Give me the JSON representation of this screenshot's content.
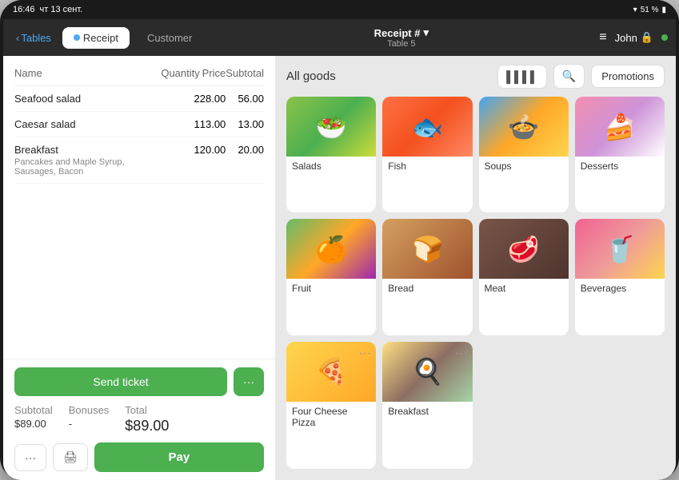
{
  "status_bar": {
    "time": "16:46",
    "date": "чт 13 сент.",
    "battery": "51 %",
    "wifi": "▾"
  },
  "nav": {
    "back_label": "Tables",
    "tabs": [
      {
        "id": "receipt",
        "label": "Receipt",
        "active": true
      },
      {
        "id": "customer",
        "label": "Customer",
        "active": false
      }
    ],
    "receipt_title": "Receipt #",
    "receipt_chevron": "▾",
    "table_subtitle": "Table 5",
    "hamburger_icon": "≡",
    "user_name": "John",
    "lock_icon": "🔒"
  },
  "order": {
    "columns": {
      "name": "Name",
      "quantity": "Quantity",
      "price": "Price",
      "subtotal": "Subtotal"
    },
    "items": [
      {
        "name": "Seafood salad",
        "description": "",
        "quantity": "2",
        "price": "28.00",
        "subtotal": "56.00"
      },
      {
        "name": "Caesar salad",
        "description": "",
        "quantity": "1",
        "price": "13.00",
        "subtotal": "13.00"
      },
      {
        "name": "Breakfast",
        "description": "Pancakes and Maple Syrup, Sausages, Bacon",
        "quantity": "1",
        "price": "20.00",
        "subtotal": "20.00"
      }
    ],
    "send_ticket_label": "Send ticket",
    "more_label": "···",
    "subtotal_label": "Subtotal",
    "subtotal_value": "$89.00",
    "bonuses_label": "Bonuses",
    "bonuses_value": "-",
    "total_label": "Total",
    "total_value": "$89.00",
    "pay_label": "Pay"
  },
  "right": {
    "all_goods_label": "All goods",
    "barcode_icon": "▌▌▌",
    "search_placeholder": "Search",
    "promotions_label": "Promotions",
    "categories": [
      {
        "id": "salads",
        "label": "Salads",
        "color_class": "food-salad",
        "emoji": "🥗"
      },
      {
        "id": "fish",
        "label": "Fish",
        "color_class": "food-fish",
        "emoji": "🐟"
      },
      {
        "id": "soups",
        "label": "Soups",
        "color_class": "food-soup",
        "emoji": "🍲"
      },
      {
        "id": "desserts",
        "label": "Desserts",
        "color_class": "food-desserts",
        "emoji": "🍰"
      },
      {
        "id": "fruit",
        "label": "Fruit",
        "color_class": "food-fruit",
        "emoji": "🍊"
      },
      {
        "id": "bread",
        "label": "Bread",
        "color_class": "food-bread",
        "emoji": "🍞"
      },
      {
        "id": "meat",
        "label": "Meat",
        "color_class": "food-meat",
        "emoji": "🥩"
      },
      {
        "id": "beverages",
        "label": "Beverages",
        "color_class": "food-beverages",
        "emoji": "🥤"
      },
      {
        "id": "four-cheese-pizza",
        "label": "Four Cheese Pizza",
        "color_class": "food-pizza",
        "emoji": "🍕",
        "has_more": true
      },
      {
        "id": "breakfast",
        "label": "Breakfast",
        "color_class": "food-breakfast",
        "emoji": "🍳",
        "has_more": true
      }
    ]
  }
}
